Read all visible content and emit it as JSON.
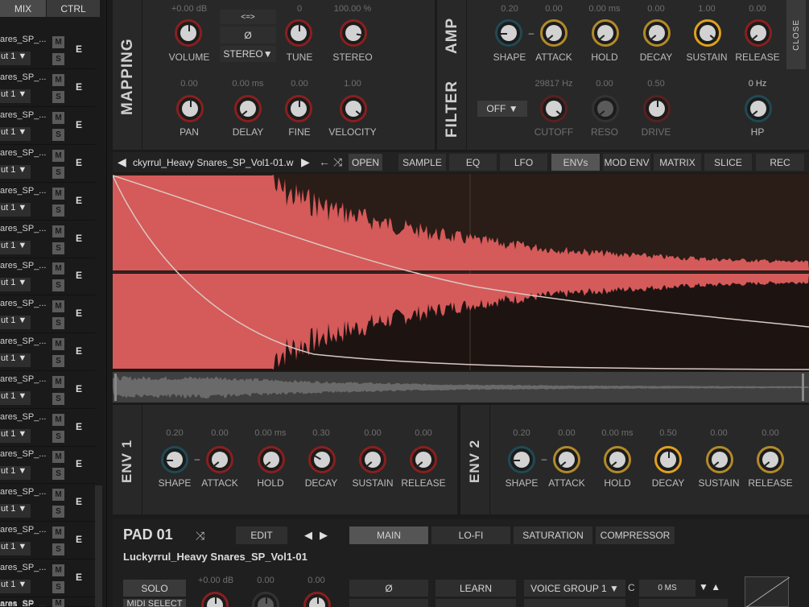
{
  "mixer": {
    "tabs": [
      "MIX",
      "CTRL"
    ],
    "rows": [
      {
        "name": "ares_SP_...",
        "out": "ut 1 ▼",
        "m": "M",
        "s": "S",
        "e": "E"
      },
      {
        "name": "ares_SP_...",
        "out": "ut 1 ▼",
        "m": "M",
        "s": "S",
        "e": "E"
      },
      {
        "name": "ares_SP_...",
        "out": "ut 1 ▼",
        "m": "M",
        "s": "S",
        "e": "E"
      },
      {
        "name": "ares_SP_...",
        "out": "ut 1 ▼",
        "m": "M",
        "s": "S",
        "e": "E"
      },
      {
        "name": "ares_SP_...",
        "out": "ut 1 ▼",
        "m": "M",
        "s": "S",
        "e": "E"
      },
      {
        "name": "ares_SP_...",
        "out": "ut 1 ▼",
        "m": "M",
        "s": "S",
        "e": "E"
      },
      {
        "name": "ares_SP_...",
        "out": "ut 1 ▼",
        "m": "M",
        "s": "S",
        "e": "E"
      },
      {
        "name": "ares_SP_...",
        "out": "ut 1 ▼",
        "m": "M",
        "s": "S",
        "e": "E"
      },
      {
        "name": "ares_SP_...",
        "out": "ut 1 ▼",
        "m": "M",
        "s": "S",
        "e": "E"
      },
      {
        "name": "ares_SP_...",
        "out": "ut 1 ▼",
        "m": "M",
        "s": "S",
        "e": "E"
      },
      {
        "name": "ares_SP_...",
        "out": "ut 1 ▼",
        "m": "M",
        "s": "S",
        "e": "E"
      },
      {
        "name": "ares_SP_...",
        "out": "ut 1 ▼",
        "m": "M",
        "s": "S",
        "e": "E"
      },
      {
        "name": "ares_SP_...",
        "out": "ut 1 ▼",
        "m": "M",
        "s": "S",
        "e": "E"
      },
      {
        "name": "ares_SP_...",
        "out": "ut 1 ▼",
        "m": "M",
        "s": "S",
        "e": "E"
      },
      {
        "name": "ares_SP_...",
        "out": "ut 1 ▼",
        "m": "M",
        "s": "S",
        "e": "E"
      },
      {
        "name": "ares_SP_...",
        "out": "ut 1 ▼",
        "m": "M",
        "s": "S",
        "e": "E"
      },
      {
        "name": "ares_SP_",
        "out": "",
        "m": "M",
        "s": "",
        "e": ""
      }
    ]
  },
  "mapping": {
    "title": "MAPPING",
    "volume": {
      "value": "+0.00 dB",
      "label": "VOLUME"
    },
    "phase_mode": {
      "value": "<=>"
    },
    "invert": {
      "value": "Ø"
    },
    "stereo_mode": {
      "value": "STEREO▼"
    },
    "tune": {
      "value": "0",
      "label": "TUNE"
    },
    "stereo": {
      "value": "100.00 %",
      "label": "STEREO"
    },
    "pan": {
      "value": "0.00",
      "label": "PAN"
    },
    "delay": {
      "value": "0.00 ms",
      "label": "DELAY"
    },
    "fine": {
      "value": "0.00",
      "label": "FINE"
    },
    "velocity": {
      "value": "1.00",
      "label": "VELOCITY"
    }
  },
  "amp": {
    "title": "AMP",
    "shape": {
      "value": "0.20",
      "label": "SHAPE"
    },
    "dash": "–",
    "attack": {
      "value": "0.00",
      "label": "ATTACK"
    },
    "hold": {
      "value": "0.00 ms",
      "label": "HOLD"
    },
    "decay": {
      "value": "0.00",
      "label": "DECAY"
    },
    "sustain": {
      "value": "1.00",
      "label": "SUSTAIN"
    },
    "release": {
      "value": "0.00",
      "label": "RELEASE"
    },
    "close": "CLOSE"
  },
  "filter": {
    "title": "FILTER",
    "type": "OFF ▼",
    "cutoff": {
      "value": "29817 Hz",
      "label": "CUTOFF"
    },
    "reso": {
      "value": "0.00",
      "label": "RESO"
    },
    "drive": {
      "value": "0.50",
      "label": "DRIVE"
    },
    "hp": {
      "value": "0 Hz",
      "label": "HP"
    }
  },
  "sample_bar": {
    "prev": "◀",
    "filename": "ckyrrul_Heavy Snares_SP_Vol1-01.w",
    "next": "▶",
    "back": "←",
    "shuffle": "⤨",
    "open": "OPEN"
  },
  "tabs": [
    "SAMPLE",
    "EQ",
    "LFO",
    "ENVs",
    "MOD ENV",
    "MATRIX",
    "SLICE",
    "REC"
  ],
  "env1": {
    "title": "ENV 1",
    "shape": {
      "value": "0.20",
      "label": "SHAPE"
    },
    "dash": "–",
    "attack": {
      "value": "0.00",
      "label": "ATTACK"
    },
    "hold": {
      "value": "0.00 ms",
      "label": "HOLD"
    },
    "decay": {
      "value": "0.30",
      "label": "DECAY"
    },
    "sustain": {
      "value": "0.00",
      "label": "SUSTAIN"
    },
    "release": {
      "value": "0.00",
      "label": "RELEASE"
    }
  },
  "env2": {
    "title": "ENV 2",
    "shape": {
      "value": "0.20",
      "label": "SHAPE"
    },
    "dash": "–",
    "attack": {
      "value": "0.00",
      "label": "ATTACK"
    },
    "hold": {
      "value": "0.00 ms",
      "label": "HOLD"
    },
    "decay": {
      "value": "0.50",
      "label": "DECAY"
    },
    "sustain": {
      "value": "0.00",
      "label": "SUSTAIN"
    },
    "release": {
      "value": "0.00",
      "label": "RELEASE"
    }
  },
  "pad": {
    "title": "PAD 01",
    "shuffle": "⤨",
    "edit": "EDIT",
    "prev": "◀",
    "next": "▶",
    "tabs": [
      "MAIN",
      "LO-FI",
      "SATURATION",
      "COMPRESSOR"
    ],
    "sample_name": "Luckyrrul_Heavy Snares_SP_Vol1-01"
  },
  "bottom": {
    "solo": "SOLO",
    "midi_select": "MIDI SELECT",
    "vol": "+0.00 dB",
    "v2": "0.00",
    "v3": "0.00",
    "invert": "Ø",
    "learn": "LEARN",
    "voice_group": "VOICE GROUP 1 ▼",
    "c": "C",
    "ms": "0 MS",
    "arrows": "▼ ▲"
  },
  "colors": {
    "waveform": "#d55a5a",
    "accent_red": "#8a1f1f",
    "accent_yellow": "#e0a020",
    "accent_cyan": "#1f4a55"
  }
}
